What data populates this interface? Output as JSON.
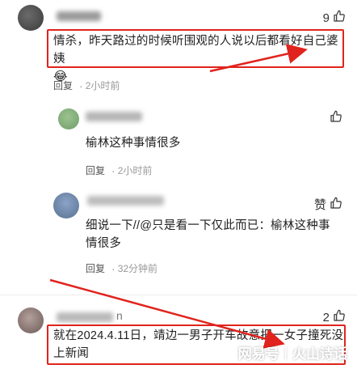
{
  "comments": [
    {
      "text": "情杀，昨天路过的时候听围观的人说以后都看好自己婆姨",
      "emoji": "😂",
      "likes": "9",
      "reply_label": "回复",
      "time": "2小时前"
    },
    {
      "text": "榆林这种事情很多",
      "likes": "0",
      "reply_label": "回复",
      "time": "2小时前"
    },
    {
      "text": "细说一下//@只是看一下仅此而已：榆林这种事情很多",
      "likes": "赞",
      "reply_label": "回复",
      "time": "32分钟前"
    },
    {
      "name_tail": "n",
      "text": "就在2024.4.11日，靖边一男子开车故意把一女子撞死没上新闻",
      "likes": "2"
    }
  ],
  "watermark": {
    "left": "网易号",
    "sep": "|",
    "right": "火山诗话"
  },
  "colors": {
    "highlight": "#e0241d",
    "arrow": "#e0241d"
  }
}
